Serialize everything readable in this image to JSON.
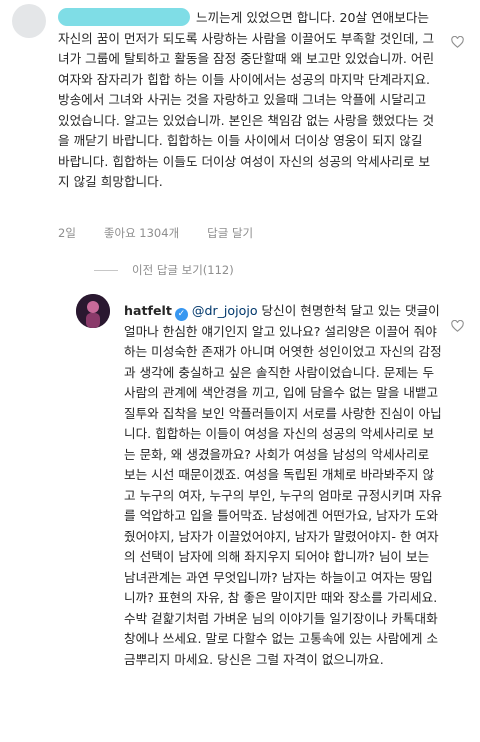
{
  "comment": {
    "text": "느끼는게 있었으면 합니다. 20살 연애보다는 자신의 꿈이 먼저가 되도록 사랑하는 사람을 이끌어도 부족할 것인데, 그녀가 그룹에 탈퇴하고 활동을 잠정 중단할때 왜 보고만 있었습니까. 어린여자와 잠자리가 힙합 하는 이들 사이에서는 성공의 마지막 단계라지요. 방송에서 그녀와 사귀는 것을 자랑하고 있을때 그녀는 악플에 시달리고 있었습니다. 알고는 있었습니까. 본인은 책임감 없는 사랑을 했었다는 것을 깨닫기 바랍니다. 힙합하는 이들 사이에서 더이상 영웅이 되지 않길 바랍니다. 힙합하는 이들도 더이상 여성이 자신의 성공의 악세사리로 보지 않길 희망합니다.",
    "time": "2일",
    "likes": "좋아요 1304개",
    "reply_label": "답글 달기",
    "like_icon": "heart-outline-icon"
  },
  "view_replies": {
    "label": "이전 답글 보기(112)"
  },
  "reply": {
    "username": "hatfelt",
    "verified_icon": "verified-badge-icon",
    "mention": "@dr_jojojo",
    "text": " 당신이 현명한척 달고 있는 댓글이 얼마나 한심한 얘기인지 알고 있나요? 설리양은 이끌어 줘야하는 미성숙한 존재가 아니며 어엿한 성인이었고 자신의 감정과 생각에 충실하고 싶은 솔직한 사람이었습니다. 문제는 두 사람의 관계에 색안경을 끼고, 입에 담을수 없는 말을 내뱉고 질투와 집착을 보인 악플러들이지 서로를 사랑한 진심이 아닙니다. 힙합하는 이들이 여성을 자신의 성공의 악세사리로 보는 문화, 왜 생겼을까요? 사회가 여성을 남성의 악세사리로 보는 시선 때문이겠죠. 여성을 독립된 개체로 바라봐주지 않고 누구의 여자, 누구의 부인, 누구의 엄마로 규정시키며 자유를 억압하고 입을 틀어막죠. 남성에겐 어떤가요, 남자가 도와줬어야지, 남자가 이끌었어야지, 남자가 말렸어야지- 한 여자의 선택이 남자에 의해 좌지우지 되어야 합니까? 님이 보는 남녀관계는 과연 무엇입니까? 남자는 하늘이고 여자는 땅입니까? 표현의 자유, 참 좋은 말이지만 때와 장소를 가리세요. 수박 겉핥기처럼 가벼운 님의 이야기들 일기장이나 카톡대화창에나 쓰세요. 말로 다할수 없는 고통속에 있는 사람에게 소금뿌리지 마세요. 당신은 그럴 자격이 없으니까요.",
    "like_icon": "heart-outline-icon"
  }
}
